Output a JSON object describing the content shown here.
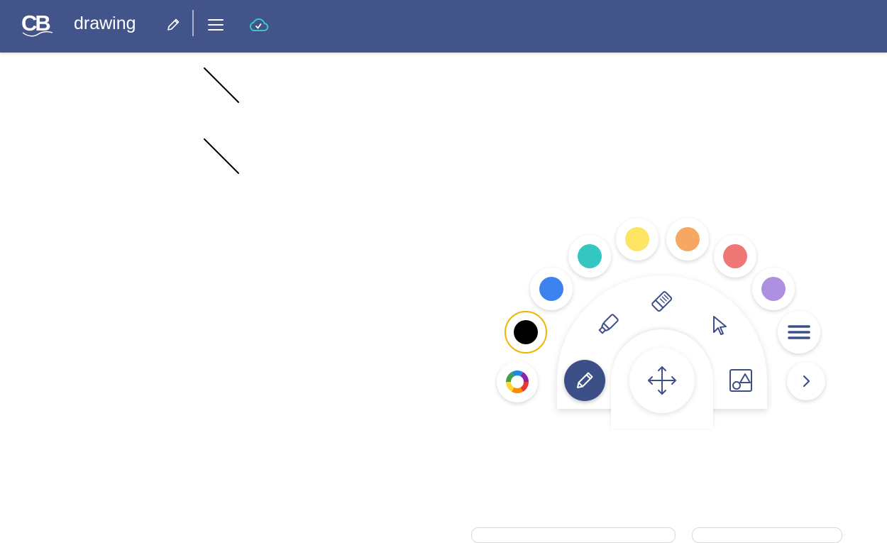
{
  "header": {
    "logo_text": "CB",
    "title": "drawing",
    "icons": {
      "edit": "pencil-icon",
      "menu": "hamburger-menu-icon",
      "cloud": "cloud-check-icon"
    }
  },
  "colors": {
    "header_bg": "#42548a",
    "accent": "#3d4f87",
    "cloud_icon": "#3cc6c0",
    "selected_ring": "#f0b400"
  },
  "palette": {
    "swatches": [
      {
        "name": "black",
        "color": "#000000",
        "selected": true
      },
      {
        "name": "blue",
        "color": "#3d83f0"
      },
      {
        "name": "teal",
        "color": "#34c6c1"
      },
      {
        "name": "yellow",
        "color": "#fde462"
      },
      {
        "name": "orange",
        "color": "#f6a862"
      },
      {
        "name": "red",
        "color": "#ef7775"
      },
      {
        "name": "purple",
        "color": "#ad91e0"
      }
    ],
    "custom": "color-wheel-icon"
  },
  "tools": {
    "pen": {
      "icon": "pencil-icon",
      "active": true
    },
    "highlighter": {
      "icon": "highlighter-icon"
    },
    "eraser": {
      "icon": "eraser-icon"
    },
    "select": {
      "icon": "cursor-arrow-icon"
    },
    "move": {
      "icon": "move-arrows-icon"
    },
    "shapes": {
      "icon": "shapes-icon"
    },
    "more": {
      "icon": "hamburger-menu-icon"
    },
    "next": {
      "icon": "chevron-right-icon"
    }
  },
  "canvas": {
    "strokes": [
      {
        "name": "stroke-1"
      },
      {
        "name": "stroke-2"
      }
    ]
  }
}
